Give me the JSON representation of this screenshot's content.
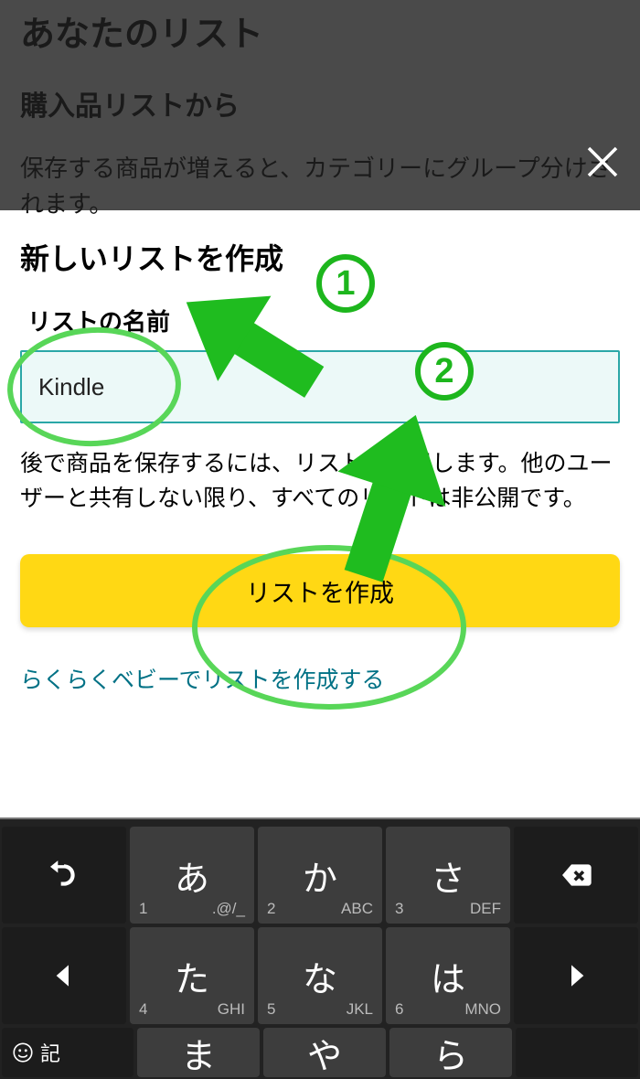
{
  "background": {
    "title": "あなたのリスト",
    "subtitle": "購入品リストから",
    "description": "保存する商品が増えると、カテゴリーにグループ分けされます。"
  },
  "modal": {
    "title": "新しいリストを作成",
    "field_label": "リストの名前",
    "input_value": "Kindle",
    "description": "後で商品を保存するには、リストを使用します。他のユーザーと共有しない限り、すべてのリストは非公開です。",
    "create_button": "リストを作成",
    "baby_link": "らくらくベビーでリストを作成する"
  },
  "annotations": {
    "badge1": "1",
    "badge2": "2"
  },
  "keyboard": {
    "row1": [
      {
        "main": "undo"
      },
      {
        "main": "あ",
        "num": "1",
        "alt": ".@/_"
      },
      {
        "main": "か",
        "num": "2",
        "alt": "ABC"
      },
      {
        "main": "さ",
        "num": "3",
        "alt": "DEF"
      },
      {
        "main": "bksp"
      }
    ],
    "row2": [
      {
        "main": "left"
      },
      {
        "main": "た",
        "num": "4",
        "alt": "GHI"
      },
      {
        "main": "な",
        "num": "5",
        "alt": "JKL"
      },
      {
        "main": "は",
        "num": "6",
        "alt": "MNO"
      },
      {
        "main": "right"
      }
    ],
    "row3": [
      {
        "main": "emoji",
        "label": "記"
      },
      {
        "main": "ま"
      },
      {
        "main": "や"
      },
      {
        "main": "ら"
      },
      {
        "main": ""
      }
    ]
  }
}
